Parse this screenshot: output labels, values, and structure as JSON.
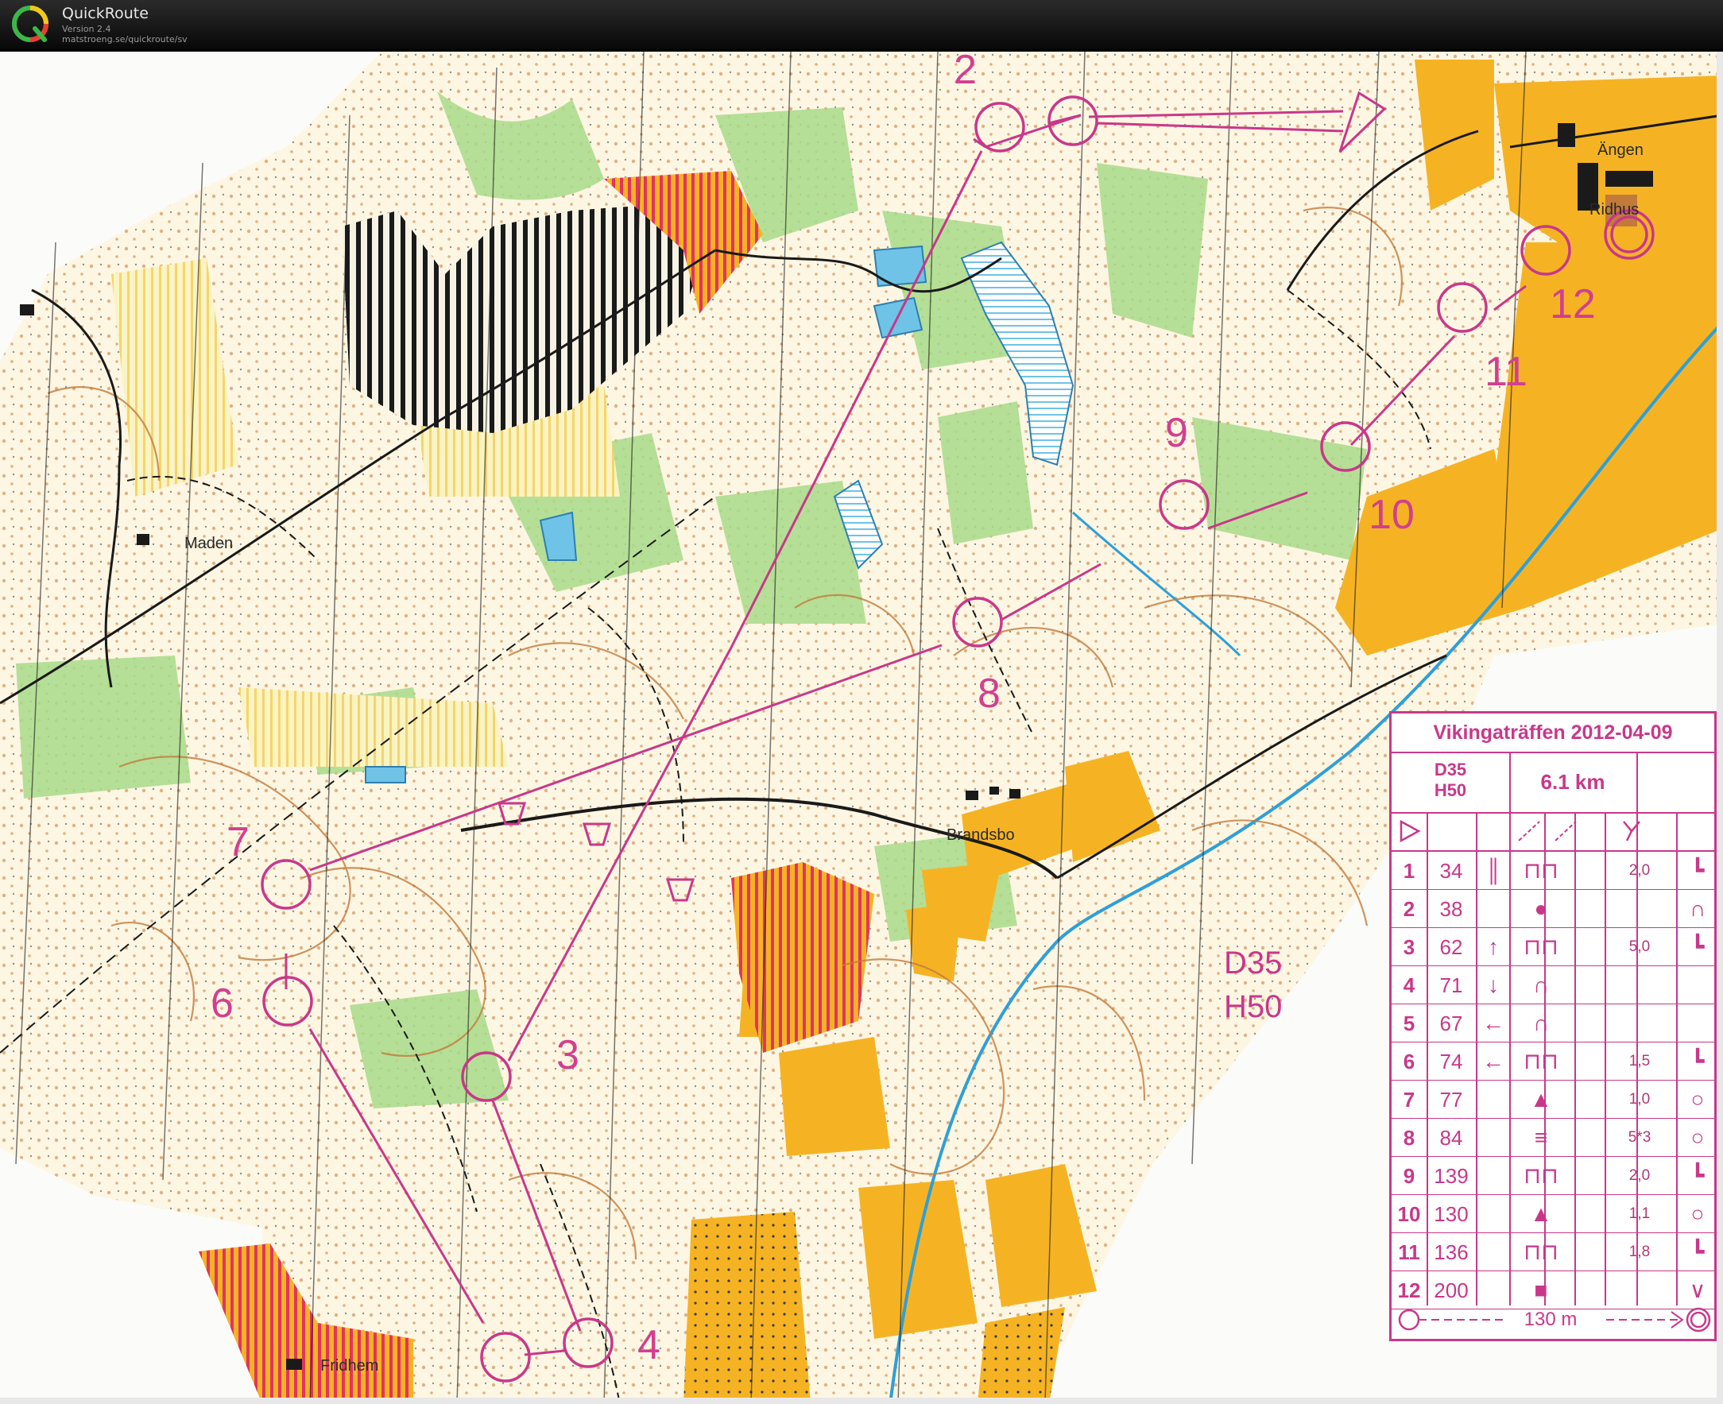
{
  "app": {
    "name": "QuickRoute",
    "version": "Version 2.4",
    "url": "matstroeng.se/quickroute/sv"
  },
  "map": {
    "places": {
      "angen": "Ängen",
      "ridhus": "Ridhus",
      "maden": "Maden",
      "brandsbo": "Brandsbo",
      "fridhem": "Fridhem"
    },
    "course_label": [
      "D35",
      "H50"
    ],
    "controls": [
      {
        "num": "2"
      },
      {
        "num": "3"
      },
      {
        "num": "4"
      },
      {
        "num": "6"
      },
      {
        "num": "7"
      },
      {
        "num": "8"
      },
      {
        "num": "9"
      },
      {
        "num": "10"
      },
      {
        "num": "11"
      },
      {
        "num": "12"
      }
    ],
    "colors": {
      "course": "#c8388a",
      "open_land": "#f5b324",
      "green": "#a8db8a",
      "water": "#6fc3e6",
      "contour": "#c27a3a",
      "marsh_red": "#e0355f"
    }
  },
  "legend": {
    "title": "Vikingaträffen 2012-04-09",
    "class_1": "D35",
    "class_2": "H50",
    "length": "6.1 km",
    "rows": [
      {
        "seq": "1",
        "code": "34",
        "sym": "║",
        "feat": "⊓⊓",
        "dim": "2,0",
        "loc": "┗"
      },
      {
        "seq": "2",
        "code": "38",
        "sym": "",
        "feat": "●",
        "dim": "",
        "loc": "∩"
      },
      {
        "seq": "3",
        "code": "62",
        "sym": "↑",
        "feat": "⊓⊓",
        "dim": "5,0",
        "loc": "┗"
      },
      {
        "seq": "4",
        "code": "71",
        "sym": "↓",
        "feat": "∩",
        "dim": "",
        "loc": ""
      },
      {
        "seq": "5",
        "code": "67",
        "sym": "←",
        "feat": "∩",
        "dim": "",
        "loc": ""
      },
      {
        "seq": "6",
        "code": "74",
        "sym": "←",
        "feat": "⊓⊓",
        "dim": "1,5",
        "loc": "┗"
      },
      {
        "seq": "7",
        "code": "77",
        "sym": "",
        "feat": "▲",
        "dim": "1,0",
        "loc": "○"
      },
      {
        "seq": "8",
        "code": "84",
        "sym": "",
        "feat": "≡",
        "dim": "5*3",
        "loc": "○"
      },
      {
        "seq": "9",
        "code": "139",
        "sym": "",
        "feat": "⊓⊓",
        "dim": "2,0",
        "loc": "┗"
      },
      {
        "seq": "10",
        "code": "130",
        "sym": "",
        "feat": "▲",
        "dim": "1,1",
        "loc": "○"
      },
      {
        "seq": "11",
        "code": "136",
        "sym": "",
        "feat": "⊓⊓",
        "dim": "1,8",
        "loc": "┗"
      },
      {
        "seq": "12",
        "code": "200",
        "sym": "",
        "feat": "■",
        "dim": "",
        "loc": "∨"
      }
    ],
    "finish_distance": "130 m"
  }
}
